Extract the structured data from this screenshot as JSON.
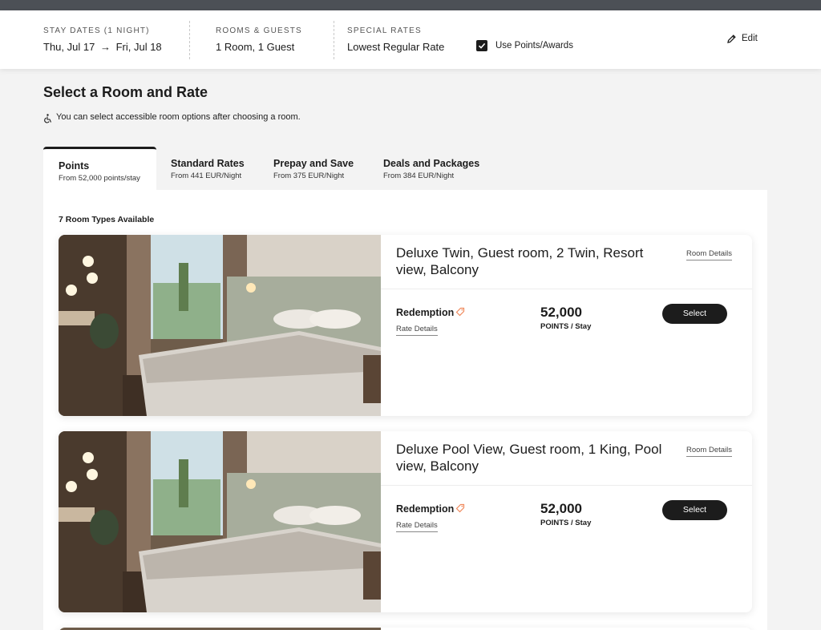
{
  "header": {
    "stay": {
      "caption": "STAY DATES (1 NIGHT)",
      "from": "Thu, Jul 17",
      "arrow": "→",
      "to": "Fri, Jul 18"
    },
    "rooms": {
      "caption": "ROOMS & GUESTS",
      "value": "1 Room, 1 Guest"
    },
    "rates": {
      "caption": "SPECIAL RATES",
      "value": "Lowest Regular Rate"
    },
    "use_points": {
      "label": "Use Points/Awards",
      "checked": true
    },
    "edit_label": "Edit"
  },
  "page": {
    "title": "Select a Room and Rate",
    "accessible_note": "You can select accessible room options after choosing a room."
  },
  "tabs": [
    {
      "label": "Points",
      "sub": "From 52,000 points/stay",
      "active": true
    },
    {
      "label": "Standard Rates",
      "sub": "From 441 EUR/Night",
      "active": false
    },
    {
      "label": "Prepay and Save",
      "sub": "From 375 EUR/Night",
      "active": false
    },
    {
      "label": "Deals and Packages",
      "sub": "From 384 EUR/Night",
      "active": false
    }
  ],
  "room_count": "7 Room Types Available",
  "rooms": [
    {
      "name": "Deluxe Twin, Guest room, 2 Twin, Resort view, Balcony",
      "details_link": "Room Details",
      "rate_name": "Redemption",
      "rate_details_link": "Rate Details",
      "points": "52,000",
      "points_unit": "POINTS / Stay",
      "select_label": "Select"
    },
    {
      "name": "Deluxe Pool View, Guest room, 1 King, Pool view, Balcony",
      "details_link": "Room Details",
      "rate_name": "Redemption",
      "rate_details_link": "Rate Details",
      "points": "52,000",
      "points_unit": "POINTS / Stay",
      "select_label": "Select"
    }
  ],
  "colors": {
    "accent": "#1c1c1c",
    "tag": "#f08a5d",
    "topbar": "#4c5056"
  }
}
